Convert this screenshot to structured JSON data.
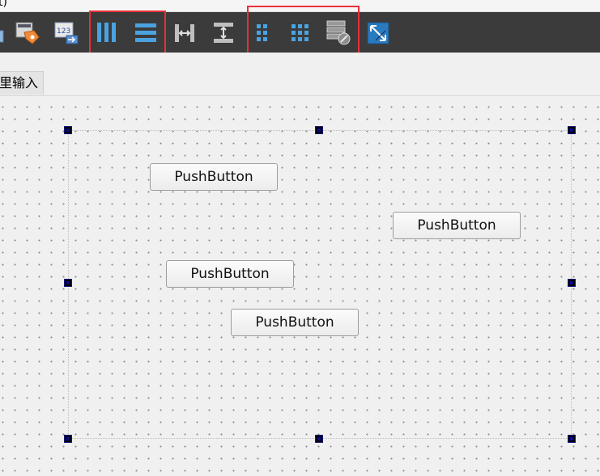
{
  "menubar": {
    "partial_text": "t)"
  },
  "toolbar": {
    "buttons": [
      {
        "name": "edit-tab-order-icon"
      },
      {
        "name": "edit-buddies-icon"
      },
      {
        "name": "layout-horizontally-icon"
      },
      {
        "name": "layout-vertically-icon"
      },
      {
        "name": "layout-horizontal-splitter-icon"
      },
      {
        "name": "layout-vertical-splitter-icon"
      },
      {
        "name": "layout-form-icon"
      },
      {
        "name": "layout-grid-icon"
      },
      {
        "name": "break-layout-icon"
      },
      {
        "name": "adjust-size-icon"
      }
    ],
    "highlight_color": "#e8303a"
  },
  "widget_box_tab": {
    "label": "里输入"
  },
  "form": {
    "buttons": [
      {
        "label": "PushButton"
      },
      {
        "label": "PushButton"
      },
      {
        "label": "PushButton"
      },
      {
        "label": "PushButton"
      }
    ]
  },
  "colors": {
    "toolbar_bg": "#3b3b3b",
    "icon_blue": "#4aa3e0",
    "selection_handle": "#000080"
  }
}
